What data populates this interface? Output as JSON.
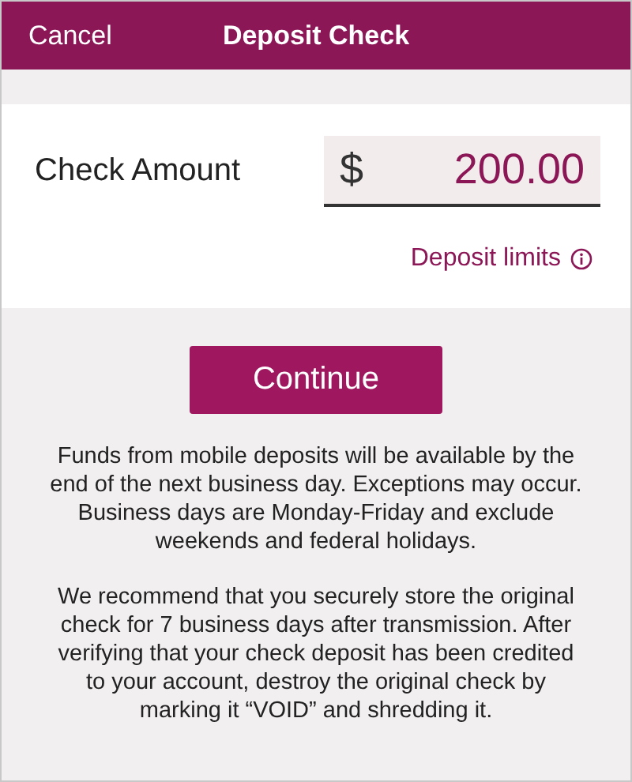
{
  "nav_bar": {
    "cancel": "Cancel",
    "title": "Deposit Check"
  },
  "amount": {
    "label": "Check Amount",
    "currency": "$",
    "value": "200.00"
  },
  "deposit_limits_link": "Deposit limits",
  "continue_button": "Continue",
  "notes": [
    "Funds from mobile deposits will be available by the end of the next business day. Exceptions may occur. Business days are Monday-Friday and exclude weekends and federal holidays.",
    "We recommend that you securely store the original check for 7 business days after transmission. After verifying that your check deposit has been credited to your account, destroy the original check by marking it “VOID” and shredding it."
  ]
}
